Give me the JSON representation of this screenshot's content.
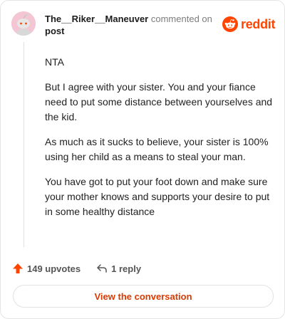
{
  "header": {
    "username": "The__Riker__Maneuver",
    "action": "commented on",
    "link": "post"
  },
  "brand": {
    "name": "reddit",
    "color": "#ff4500",
    "icon": "reddit-logo-icon"
  },
  "comment": {
    "paragraphs": [
      "NTA",
      "But I agree with your sister. You and your fiance need to put some distance between yourselves and the kid.",
      "As much as it sucks to believe, your sister is 100% using her child as a means to steal your man.",
      "You have got to put your foot down and make sure your mother knows and supports your desire to put in some healthy distance"
    ]
  },
  "footer": {
    "upvotes": "149 upvotes",
    "upvote_icon": "upvote-arrow-icon",
    "replies": "1 reply",
    "reply_icon": "reply-arrow-icon"
  },
  "cta": {
    "label": "View the conversation",
    "color": "#d93a00"
  }
}
